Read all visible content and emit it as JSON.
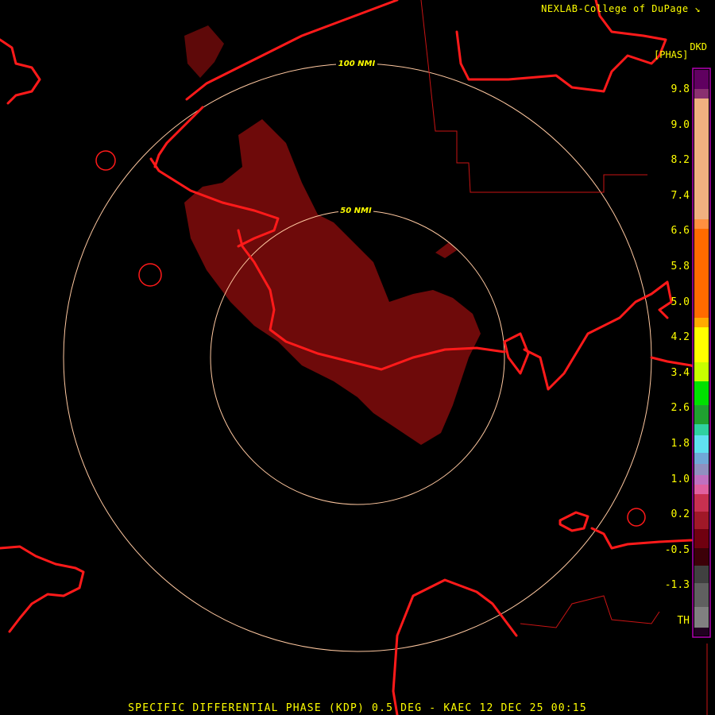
{
  "header": {
    "credit": "NEXLAB-College of DuPage",
    "credit_icon": "arrow-corner-icon"
  },
  "product": {
    "code": "DKD",
    "unit": "[PHAS]"
  },
  "range_rings": [
    {
      "label": "50 NMI"
    },
    {
      "label": "100 NMI"
    }
  ],
  "color_scale": {
    "tick_labels": [
      "9.8",
      "9.0",
      "8.2",
      "7.4",
      "6.6",
      "5.8",
      "5.0",
      "4.2",
      "3.4",
      "2.6",
      "1.8",
      "1.0",
      "0.2",
      "-0.5",
      "-1.3",
      "TH"
    ],
    "colors": {
      "bg": "#000000",
      "coastline": "#ff1a1a",
      "ring": "#ffc8a0",
      "echo": "#6e0a0a",
      "text": "#ffff00"
    }
  },
  "footer": {
    "caption": "SPECIFIC DIFFERENTIAL PHASE (KDP) 0.5 DEG - KAEC 12 DEC 25 00:15"
  }
}
